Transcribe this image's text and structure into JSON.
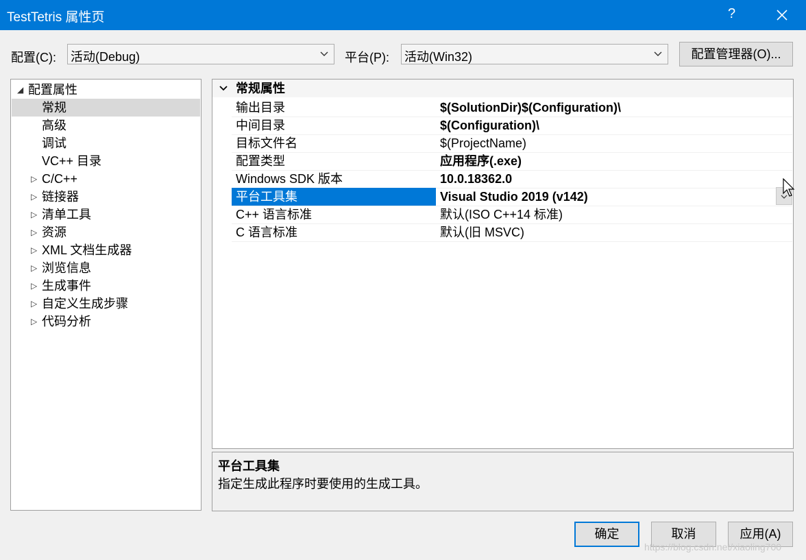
{
  "window": {
    "title": "TestTetris 属性页",
    "help_label": "?",
    "close_icon": "close-icon"
  },
  "toolbar": {
    "config_label": "配置(C):",
    "config_value": "活动(Debug)",
    "platform_label": "平台(P):",
    "platform_value": "活动(Win32)",
    "config_manager_label": "配置管理器(O)..."
  },
  "tree": {
    "items": [
      {
        "label": "配置属性",
        "expander": "◢"
      },
      {
        "label": "常规",
        "expander": ""
      },
      {
        "label": "高级",
        "expander": ""
      },
      {
        "label": "调试",
        "expander": ""
      },
      {
        "label": "VC++ 目录",
        "expander": ""
      },
      {
        "label": "C/C++",
        "expander": "▷"
      },
      {
        "label": "链接器",
        "expander": "▷"
      },
      {
        "label": "清单工具",
        "expander": "▷"
      },
      {
        "label": "资源",
        "expander": "▷"
      },
      {
        "label": "XML 文档生成器",
        "expander": "▷"
      },
      {
        "label": "浏览信息",
        "expander": "▷"
      },
      {
        "label": "生成事件",
        "expander": "▷"
      },
      {
        "label": "自定义生成步骤",
        "expander": "▷"
      },
      {
        "label": "代码分析",
        "expander": "▷"
      }
    ],
    "selected": "常规"
  },
  "grid": {
    "category": "常规属性",
    "rows": [
      {
        "name": "输出目录",
        "value": "$(SolutionDir)$(Configuration)\\"
      },
      {
        "name": "中间目录",
        "value": "$(Configuration)\\"
      },
      {
        "name": "目标文件名",
        "value": "$(ProjectName)"
      },
      {
        "name": "配置类型",
        "value": "应用程序(.exe)"
      },
      {
        "name": "Windows SDK 版本",
        "value": "10.0.18362.0"
      },
      {
        "name": "平台工具集",
        "value": "Visual Studio 2019 (v142)"
      },
      {
        "name": "C++ 语言标准",
        "value": "默认(ISO C++14 标准)"
      },
      {
        "name": "C 语言标准",
        "value": "默认(旧 MSVC)"
      }
    ],
    "selected_row": "平台工具集"
  },
  "description": {
    "title": "平台工具集",
    "text": "指定生成此程序时要使用的生成工具。"
  },
  "buttons": {
    "ok": "确定",
    "cancel": "取消",
    "apply": "应用(A)"
  },
  "watermark": "https://blog.csdn.net/xiaoling700",
  "colors": {
    "accent": "#0078d7",
    "window_bg": "#f0f0f0",
    "selected_tree_bg": "#d9d9d9"
  }
}
